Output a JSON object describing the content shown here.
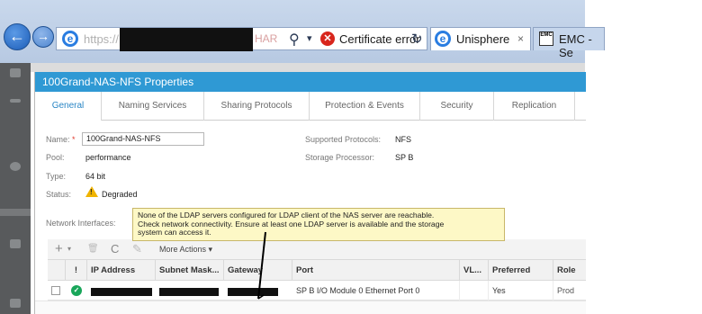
{
  "browser": {
    "url_prefix": "https://",
    "url_suffix": "HAR",
    "cert_error": "Certificate error",
    "tabs": [
      {
        "label": "Unisphere",
        "close": "×"
      },
      {
        "label": "EMC - Se"
      }
    ],
    "emc_icon_text": "EMC"
  },
  "dialog": {
    "title": "100Grand-NAS-NFS Properties",
    "tabs": [
      "General",
      "Naming Services",
      "Sharing Protocols",
      "Protection & Events",
      "Security",
      "Replication"
    ],
    "fields": {
      "name_label": "Name:",
      "name_required": "*",
      "name_value": "100Grand-NAS-NFS",
      "pool_label": "Pool:",
      "pool_value": "performance",
      "type_label": "Type:",
      "type_value": "64 bit",
      "status_label": "Status:",
      "status_value": "Degraded",
      "supported_protocols_label": "Supported Protocols:",
      "supported_protocols_value": "NFS",
      "storage_processor_label": "Storage Processor:",
      "storage_processor_value": "SP B",
      "network_interfaces_label": "Network Interfaces:"
    },
    "tooltip": {
      "line1": "None of the LDAP servers configured for LDAP client of the NAS server are reachable.",
      "line2": "Check network connectivity. Ensure at least one LDAP server is available and the storage",
      "line3": "system can access it."
    },
    "toolbar": {
      "add": "+",
      "add_caret": "▾",
      "delete": "🗑",
      "refresh": "C",
      "edit": "✎",
      "more_actions": "More Actions ▾"
    },
    "table": {
      "columns": [
        "!",
        "IP Address",
        "Subnet Mask...",
        "Gateway",
        "Port",
        "VL...",
        "Preferred",
        "Role"
      ],
      "rows": [
        {
          "port": "SP B I/O Module 0 Ethernet Port 0",
          "vlan": "",
          "preferred": "Yes",
          "role": "Prod"
        }
      ]
    }
  },
  "colors": {
    "title_bar": "#2f99d4",
    "active_tab": "#2a86c5",
    "ok_status": "#19a65a",
    "warning": "#f0b400",
    "error": "#d8261d"
  }
}
